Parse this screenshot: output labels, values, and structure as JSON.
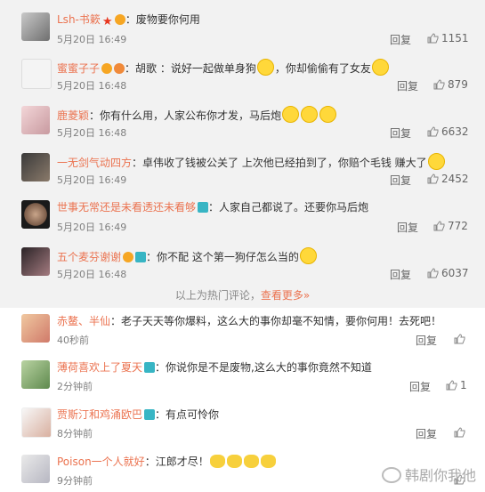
{
  "hot_comments": [
    {
      "user": "Lsh-书簌",
      "text": "：废物要你何用",
      "time": "5月20日 16:49",
      "reply": "回复",
      "likes": "1151"
    },
    {
      "user": "蜜蜜子子",
      "text": "：胡歌 ：说好一起做单身狗",
      "text2": "，你却偷偷有了女友",
      "time": "5月20日 16:48",
      "reply": "回复",
      "likes": "879"
    },
    {
      "user": "鹿菱颖",
      "text": "：你有什么用，人家公布你才发，马后炮",
      "time": "5月20日 16:48",
      "reply": "回复",
      "likes": "6632"
    },
    {
      "user": "一无剑气动四方",
      "text": "：卓伟收了钱被公关了 上次他已经拍到了，你赔个毛钱 赚大了",
      "time": "5月20日 16:49",
      "reply": "回复",
      "likes": "2452"
    },
    {
      "user": "世事无常还是未看透还未看够",
      "text": "：人家自己都说了。还要你马后炮",
      "time": "5月20日 16:49",
      "reply": "回复",
      "likes": "772"
    },
    {
      "user": "五个麦芬谢谢",
      "text": "：你不配 这个第一狗仔怎么当的",
      "time": "5月20日 16:48",
      "reply": "回复",
      "likes": "6037"
    }
  ],
  "separator": {
    "text": "以上为热门评论，",
    "link": "查看更多»"
  },
  "comments": [
    {
      "user": "赤鳌、半仙",
      "text": "：老子天天等你爆料，这么大的事你却毫不知情，要你何用！去死吧！",
      "time": "40秒前",
      "reply": "回复",
      "likes": ""
    },
    {
      "user": "薄荷喜欢上了夏天",
      "text": "：你说你是不是废物,这么大的事你竟然不知道",
      "time": "2分钟前",
      "reply": "回复",
      "likes": "1"
    },
    {
      "user": "贾斯汀和鸡涌欧巴",
      "text": "：有点可怜你",
      "time": "8分钟前",
      "reply": "回复",
      "likes": ""
    },
    {
      "user": "Poison一个人就好",
      "text": "：江郎才尽！",
      "time": "9分钟前",
      "reply": "回复",
      "likes": ""
    }
  ],
  "watermark": "韩剧你我他"
}
